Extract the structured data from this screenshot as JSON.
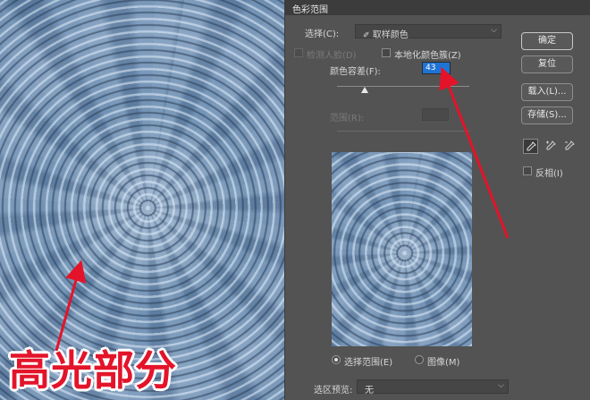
{
  "photo": {
    "caption": "高光部分"
  },
  "dialog": {
    "title": "色彩范围",
    "select": {
      "label": "选择(C):",
      "value": "取样颜色"
    },
    "detect_faces": {
      "label": "检测人脸(D)",
      "enabled": false
    },
    "localized_clusters": {
      "label": "本地化颜色簇(Z)",
      "checked": false
    },
    "fuzziness": {
      "label": "颜色容差(F):",
      "value": "43",
      "slider_fraction": 0.21
    },
    "range": {
      "label": "范围(R):",
      "value": ""
    },
    "buttons": {
      "ok": "确定",
      "reset": "复位",
      "load": "载入(L)...",
      "save": "存储(S)..."
    },
    "eyedroppers": [
      "eyedropper-icon",
      "eyedropper-plus-icon",
      "eyedropper-minus-icon"
    ],
    "invert": {
      "label": "反相(I)",
      "checked": false
    },
    "view": {
      "selection": {
        "label": "选择范围(E)",
        "checked": true
      },
      "image": {
        "label": "图像(M)",
        "checked": false
      }
    },
    "selection_preview": {
      "label": "选区预览:",
      "value": "无"
    }
  },
  "colors": {
    "annotation": "#e3142a",
    "selected_field": "#1f73d6"
  }
}
